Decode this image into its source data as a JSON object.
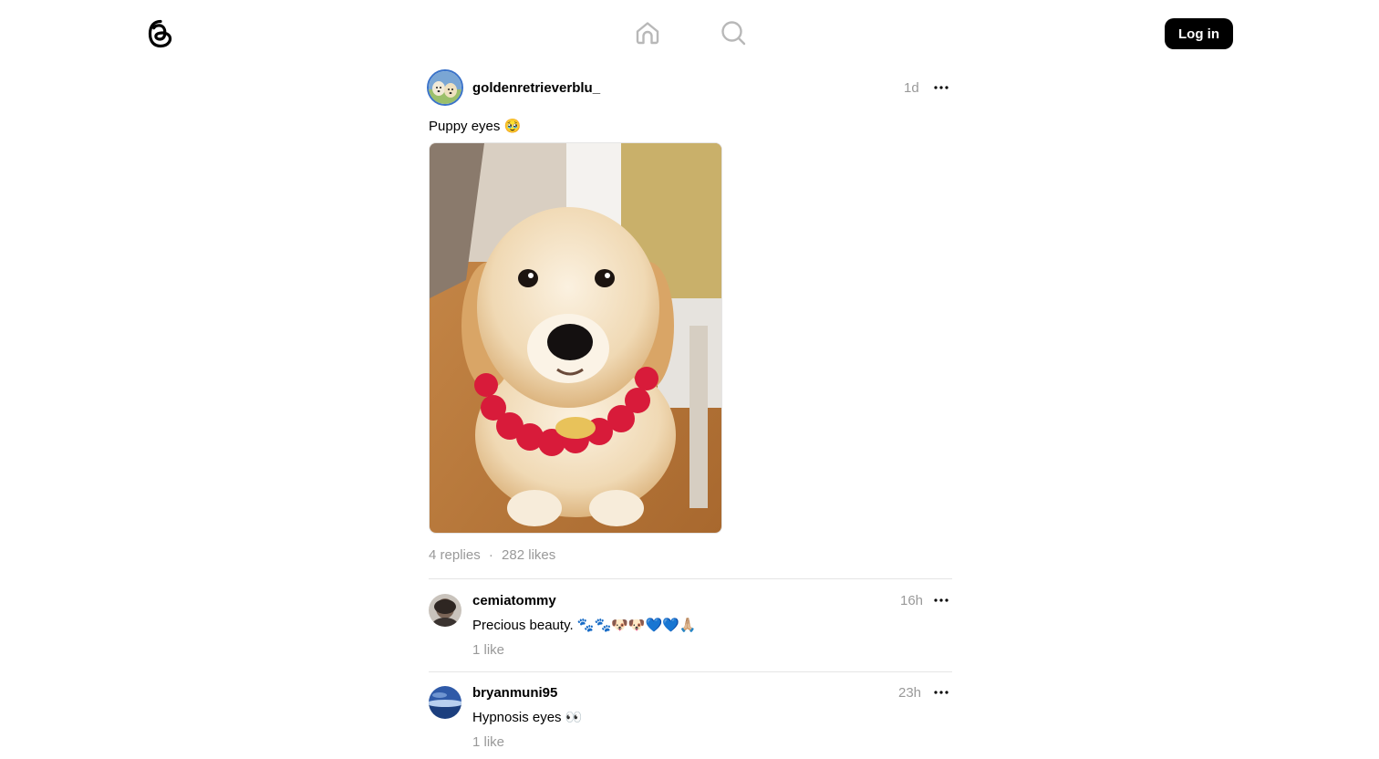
{
  "header": {
    "logo_icon": "threads-logo-icon",
    "nav": [
      {
        "name": "home",
        "icon": "home-icon"
      },
      {
        "name": "search",
        "icon": "search-icon"
      }
    ],
    "login_label": "Log in"
  },
  "post": {
    "username": "goldenretrieverblu_",
    "time": "1d",
    "text": "Puppy eyes 🥹",
    "image_icon": "golden-retriever-puppy-photo",
    "replies": "4 replies",
    "separator": "·",
    "likes": "282 likes"
  },
  "replies": [
    {
      "username": "cemiatommy",
      "time": "16h",
      "text": "Precious beauty. 🐾🐾🐶🐶💙💙🙏🏼",
      "likes": "1 like"
    },
    {
      "username": "bryanmuni95",
      "time": "23h",
      "text": "Hypnosis eyes 👀",
      "likes": "1 like"
    }
  ],
  "colors": {
    "accent": "#000000",
    "muted": "#999999",
    "divider": "#e5e5e5",
    "avatar_ring": "#3b73c9"
  }
}
